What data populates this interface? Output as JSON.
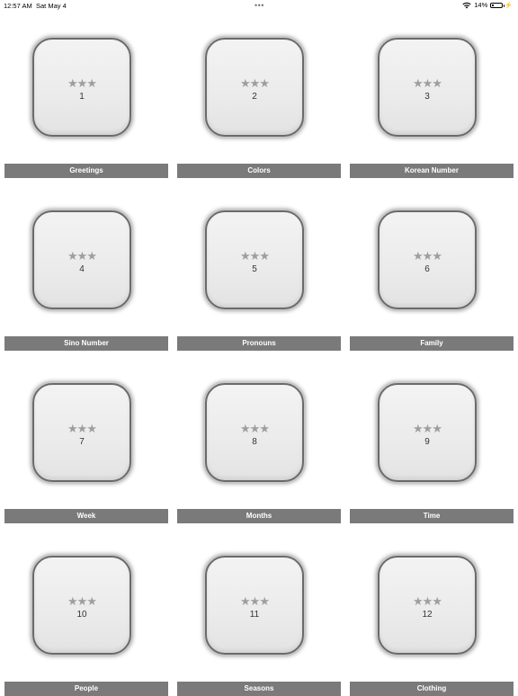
{
  "status_bar": {
    "time": "12:57 AM",
    "date": "Sat May 4",
    "dots": "•••",
    "battery_percent": "14%",
    "battery_level": 0.14
  },
  "lessons": [
    {
      "label": "Greetings",
      "number": "1",
      "stars": "★★★"
    },
    {
      "label": "Colors",
      "number": "2",
      "stars": "★★★"
    },
    {
      "label": "Korean Number",
      "number": "3",
      "stars": "★★★"
    },
    {
      "label": "Sino Number",
      "number": "4",
      "stars": "★★★"
    },
    {
      "label": "Pronouns",
      "number": "5",
      "stars": "★★★"
    },
    {
      "label": "Family",
      "number": "6",
      "stars": "★★★"
    },
    {
      "label": "Week",
      "number": "7",
      "stars": "★★★"
    },
    {
      "label": "Months",
      "number": "8",
      "stars": "★★★"
    },
    {
      "label": "Time",
      "number": "9",
      "stars": "★★★"
    },
    {
      "label": "People",
      "number": "10",
      "stars": "★★★"
    },
    {
      "label": "Seasons",
      "number": "11",
      "stars": "★★★"
    },
    {
      "label": "Clothing",
      "number": "12",
      "stars": "★★★"
    }
  ]
}
